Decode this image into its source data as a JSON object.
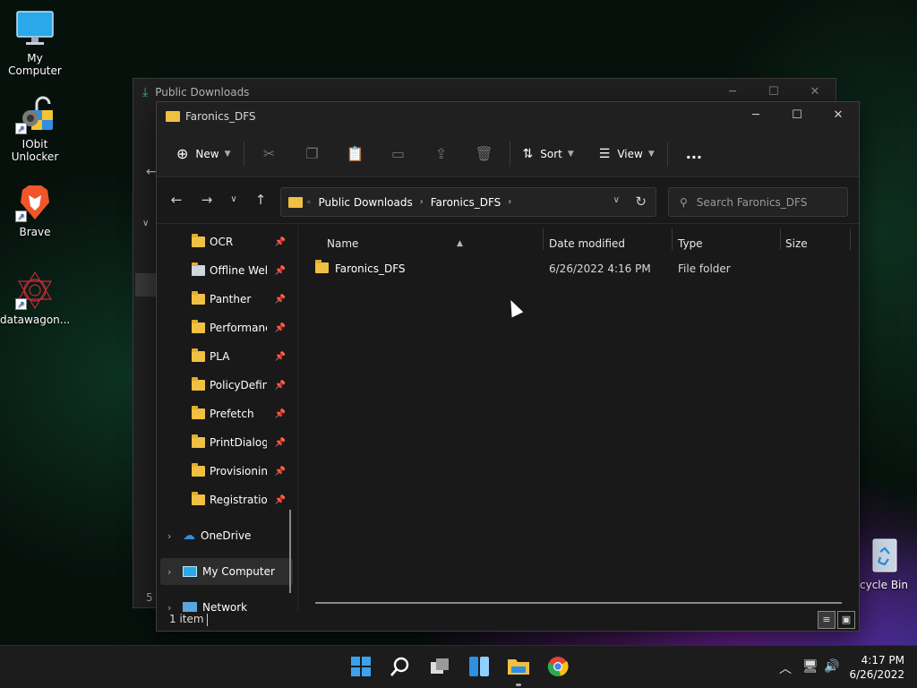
{
  "desktop": {
    "icons": [
      {
        "label": "My Computer",
        "icon": "monitor-icon"
      },
      {
        "label": "IObit Unlocker",
        "icon": "unlocker-icon"
      },
      {
        "label": "Brave",
        "icon": "brave-icon"
      },
      {
        "label": "datawagon...",
        "icon": "datawagon-icon"
      },
      {
        "label": "cycle Bin",
        "icon": "recycle-bin-icon"
      }
    ]
  },
  "back_window": {
    "title": "Public Downloads",
    "status": "5 i"
  },
  "window": {
    "title": "Faronics_DFS",
    "toolbar": {
      "new_label": "New",
      "sort_label": "Sort",
      "view_label": "View",
      "more_label": "..."
    },
    "address": {
      "crumbs": [
        "Public Downloads",
        "Faronics_DFS"
      ],
      "search_placeholder": "Search Faronics_DFS"
    },
    "nav": {
      "quick_access": [
        {
          "label": "OCR",
          "icon": "folder-icon"
        },
        {
          "label": "Offline Web",
          "icon": "offline-web-icon"
        },
        {
          "label": "Panther",
          "icon": "folder-icon"
        },
        {
          "label": "Performanc",
          "icon": "folder-icon"
        },
        {
          "label": "PLA",
          "icon": "folder-icon"
        },
        {
          "label": "PolicyDefini",
          "icon": "folder-icon"
        },
        {
          "label": "Prefetch",
          "icon": "folder-icon"
        },
        {
          "label": "PrintDialog",
          "icon": "folder-icon"
        },
        {
          "label": "Provisioning",
          "icon": "folder-icon"
        },
        {
          "label": "Registration",
          "icon": "folder-icon"
        }
      ],
      "onedrive": "OneDrive",
      "mycomputer": "My Computer",
      "network": "Network"
    },
    "columns": {
      "name": "Name",
      "date": "Date modified",
      "type": "Type",
      "size": "Size"
    },
    "rows": [
      {
        "name": "Faronics_DFS",
        "date": "6/26/2022 4:16 PM",
        "type": "File folder",
        "size": ""
      }
    ],
    "status": {
      "count": "1 item"
    }
  },
  "taskbar": {
    "apps": [
      "start-icon",
      "search-icon",
      "task-view-icon",
      "widgets-icon",
      "file-explorer-icon",
      "chrome-icon"
    ],
    "clock": {
      "time": "4:17 PM",
      "date": "6/26/2022"
    }
  },
  "colors": {
    "folder": "#f0c043",
    "window_bg": "#191919",
    "toolbar_bg": "#202020",
    "taskbar_bg": "#1c1c1c"
  }
}
